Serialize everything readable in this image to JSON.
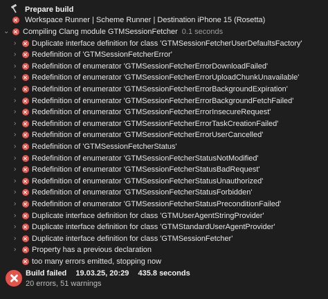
{
  "header": {
    "title": "Prepare build",
    "subtitle": "Workspace Runner | Scheme Runner | Destination iPhone 15 (Rosetta)"
  },
  "group": {
    "label": "Compiling Clang module GTMSessionFetcher",
    "duration": "0.1 seconds"
  },
  "issues": [
    "Duplicate interface definition for class 'GTMSessionFetcherUserDefaultsFactory'",
    "Redefinition of 'GTMSessionFetcherError'",
    "Redefinition of enumerator 'GTMSessionFetcherErrorDownloadFailed'",
    "Redefinition of enumerator 'GTMSessionFetcherErrorUploadChunkUnavailable'",
    "Redefinition of enumerator 'GTMSessionFetcherErrorBackgroundExpiration'",
    "Redefinition of enumerator 'GTMSessionFetcherErrorBackgroundFetchFailed'",
    "Redefinition of enumerator 'GTMSessionFetcherErrorInsecureRequest'",
    "Redefinition of enumerator 'GTMSessionFetcherErrorTaskCreationFailed'",
    "Redefinition of enumerator 'GTMSessionFetcherErrorUserCancelled'",
    "Redefinition of 'GTMSessionFetcherStatus'",
    "Redefinition of enumerator 'GTMSessionFetcherStatusNotModified'",
    "Redefinition of enumerator 'GTMSessionFetcherStatusBadRequest'",
    "Redefinition of enumerator 'GTMSessionFetcherStatusUnauthorized'",
    "Redefinition of enumerator 'GTMSessionFetcherStatusForbidden'",
    "Redefinition of enumerator 'GTMSessionFetcherStatusPreconditionFailed'",
    "Duplicate interface definition for class 'GTMUserAgentStringProvider'",
    "Duplicate interface definition for class 'GTMStandardUserAgentProvider'",
    "Duplicate interface definition for class 'GTMSessionFetcher'",
    "Property has a previous declaration"
  ],
  "final_issue": "too many errors emitted, stopping now",
  "footer": {
    "status": "Build failed",
    "date": "19.03.25, 20:29",
    "duration": "435.8 seconds",
    "summary": "20 errors, 51 warnings"
  },
  "colors": {
    "error": "#e5534b",
    "background": "#1e1e1e"
  }
}
